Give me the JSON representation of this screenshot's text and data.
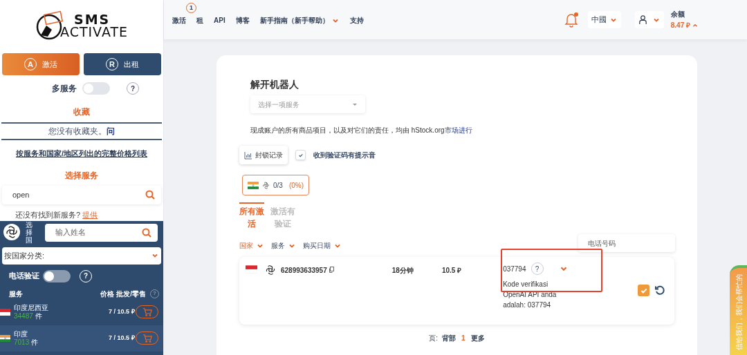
{
  "logo": {
    "line_1": "SMS",
    "line_2": "ACTIVATE"
  },
  "sidebar": {
    "mode_buttons": [
      {
        "label": "激活",
        "letter": "A",
        "selected": true
      },
      {
        "label": "出租",
        "letter": "R",
        "selected": false
      }
    ],
    "multi_service": {
      "label": "多服务",
      "on": false,
      "help": "?"
    },
    "favorites": {
      "title": "收藏",
      "empty_text": "您没有收藏夹。",
      "link": "问"
    },
    "price_list_link": "按服务和国家/地区列出的完整价格列表",
    "select_service_title": "选择服务",
    "service_search": {
      "value": "open"
    },
    "suggest": {
      "text": "还没有找到新服务?",
      "link": "提供"
    },
    "country_panel": {
      "label": "选择国",
      "search_placeholder": "输入姓名",
      "sort_select": "按国家分类:",
      "phone_verify": {
        "label": "电话验证",
        "on": false,
        "help": "?"
      },
      "columns": [
        "服务",
        "价格 批发/零售"
      ],
      "columns_help": "?",
      "rows": [
        {
          "kind": "id",
          "name": "印度尼西亚",
          "count": "34487",
          "unit": "件",
          "price": "7 / 10.5 ₽",
          "selected": false
        },
        {
          "kind": "in",
          "name": "印度",
          "count": "7013",
          "unit": "件",
          "price": "7 / 10.5 ₽",
          "selected": true
        }
      ]
    }
  },
  "header": {
    "nav": [
      {
        "label": "激活",
        "badge": "1",
        "dropdown": false
      },
      {
        "label": "租",
        "dropdown": false
      },
      {
        "label": "API",
        "dropdown": false
      },
      {
        "label": "博客",
        "dropdown": false
      },
      {
        "label": "新手指南（新手帮助）",
        "dropdown": true
      },
      {
        "label": "支持",
        "dropdown": false
      }
    ],
    "notification": {
      "unread": true
    },
    "language": "中國",
    "balance_label": "余额",
    "balance": "8.47 ₽"
  },
  "main": {
    "title": "解开机器人",
    "service_select": {
      "placeholder": "选择一项服务"
    },
    "disclaimer": "现成账户的所有商品项目，以及对它们的责任，均由 hStock.org",
    "disclaimer_link": "市场进行",
    "block_log_button": "封锁记录",
    "sound_checkbox": {
      "label": "收到验证码有提示音",
      "checked": true
    },
    "stat_chip": {
      "kind": "in",
      "count": "0/3",
      "percent": "(0%)"
    },
    "tabs": [
      {
        "label": "所有激活",
        "selected": true
      },
      {
        "label": "激活有验证",
        "selected": false
      }
    ],
    "filters": [
      {
        "label": "国家",
        "selected": true
      },
      {
        "label": "服务",
        "selected": false
      },
      {
        "label": "购买日期",
        "selected": false
      }
    ],
    "phone_search": {
      "placeholder": "电话号码"
    },
    "orders": [
      {
        "kind": "id",
        "number": "628993633957",
        "time": "18分钟",
        "price": "10.5 ₽",
        "code": "037794",
        "help": "?",
        "message": "Kode verifikasi OpenAI API anda adalah: 037794",
        "done": true,
        "highlighted": true
      }
    ],
    "pagination": {
      "label": "页:",
      "back": "背部",
      "pages": [
        {
          "label": "1",
          "selected": true
        }
      ],
      "more": "更多"
    }
  },
  "side_tab": {
    "text": "信给我们，我们会帮忙的"
  }
}
